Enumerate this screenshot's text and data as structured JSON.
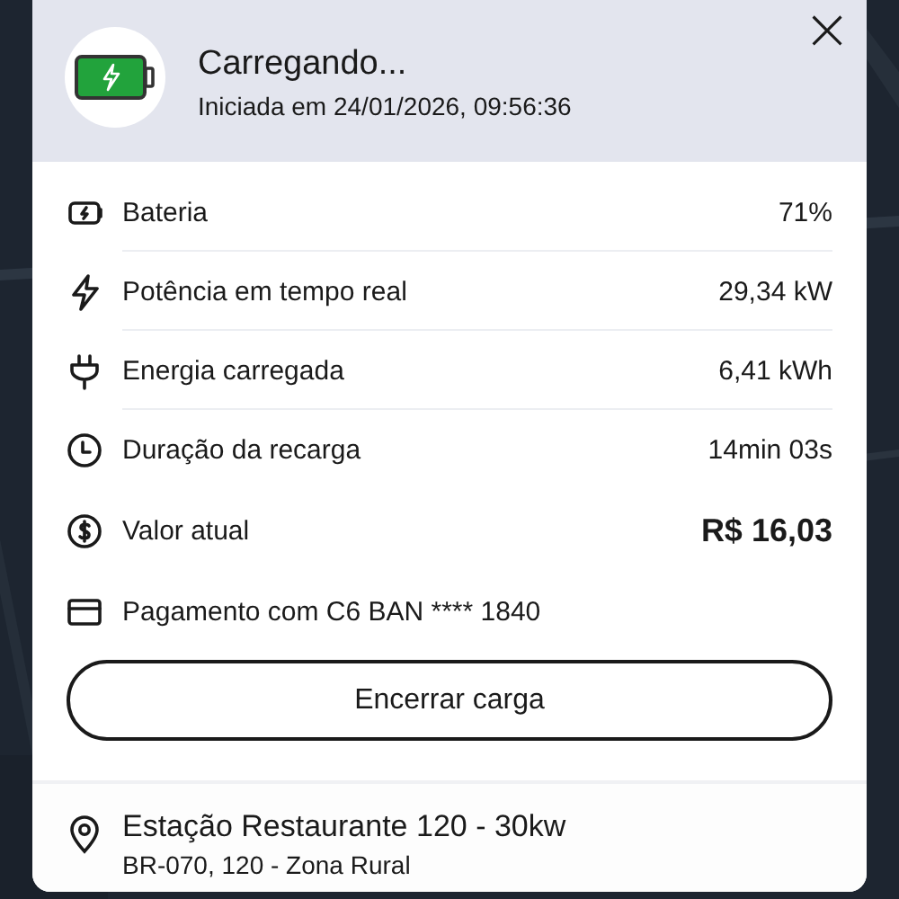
{
  "header": {
    "title": "Carregando...",
    "subtitle": "Iniciada em 24/01/2026, 09:56:36",
    "close": "×"
  },
  "details": [
    {
      "kind": "battery",
      "label": "Bateria",
      "value": "71%",
      "highlight": false,
      "divider": true
    },
    {
      "kind": "bolt",
      "label": "Potência em tempo real",
      "value": "29,34 kW",
      "highlight": false,
      "divider": true
    },
    {
      "kind": "plug",
      "label": "Energia carregada",
      "value": "6,41 kWh",
      "highlight": false,
      "divider": true
    },
    {
      "kind": "clock",
      "label": "Duração da recarga",
      "value": "14min 03s",
      "highlight": false,
      "divider": false
    },
    {
      "kind": "dollar",
      "label": "Valor atual",
      "value": "R$ 16,03",
      "highlight": true,
      "divider": false
    },
    {
      "kind": "card",
      "label": "Pagamento com C6 BAN **** 1840",
      "highlight": false,
      "divider": false
    }
  ],
  "button": "Encerrar carga",
  "station": {
    "name": "Estação Restaurante 120 - 30kw",
    "address": "BR-070, 120 - Zona Rural"
  }
}
